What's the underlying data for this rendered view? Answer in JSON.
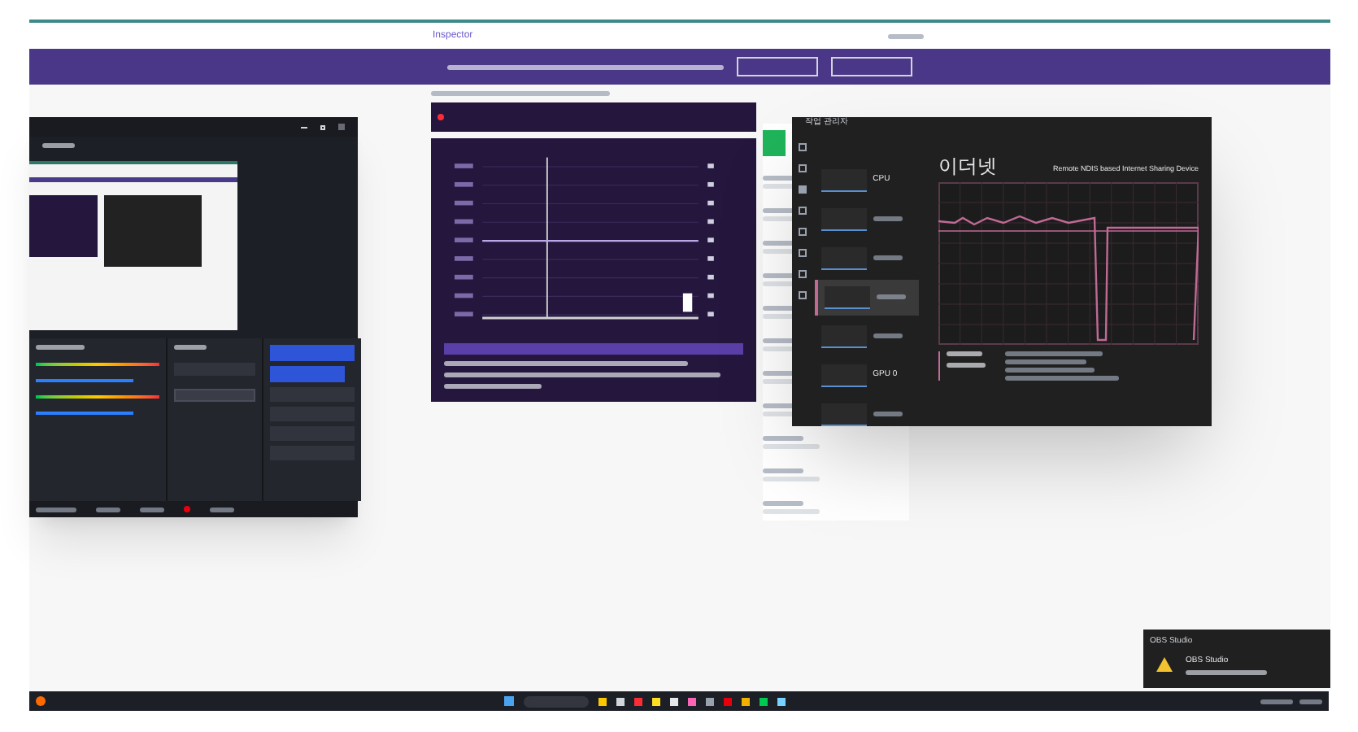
{
  "browser": {
    "logo": "Inspector"
  },
  "task_manager": {
    "title": "작업 관리자",
    "heading": "이더넷",
    "device": "Remote NDIS based Internet Sharing Device",
    "items": [
      {
        "label": "CPU",
        "selected": false
      },
      {
        "selected": false
      },
      {
        "selected": false
      },
      {
        "selected": true
      },
      {
        "selected": false
      },
      {
        "label": "GPU 0",
        "selected": false
      },
      {
        "selected": false
      }
    ]
  },
  "notification": {
    "app": "OBS Studio",
    "title": "OBS Studio"
  }
}
